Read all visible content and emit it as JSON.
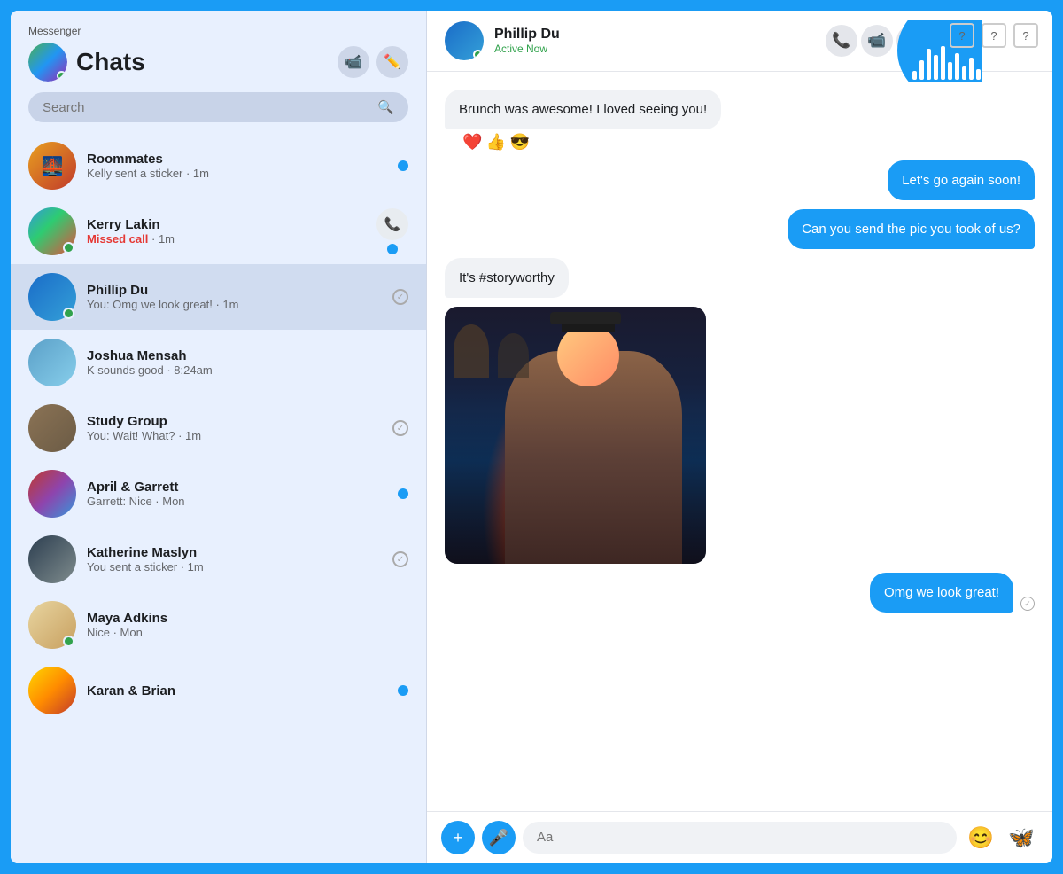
{
  "app": {
    "title": "Messenger",
    "border_color": "#1a9cf5"
  },
  "sidebar": {
    "title": "Chats",
    "search_placeholder": "Search",
    "header_actions": {
      "video_label": "📹",
      "compose_label": "✏️"
    },
    "chats": [
      {
        "id": "roommates",
        "name": "Roommates",
        "preview": "Kelly sent a sticker · 1m",
        "unread": true,
        "online": false,
        "avatar_type": "roommates",
        "avatar_emoji": "🌉"
      },
      {
        "id": "kerry-lakin",
        "name": "Kerry Lakin",
        "preview": "Missed call · 1m",
        "missed_call": true,
        "unread": true,
        "online": true,
        "avatar_type": "kerry",
        "show_phone": true
      },
      {
        "id": "phillip-du",
        "name": "Phillip Du",
        "preview": "You: Omg we look great! · 1m",
        "unread": false,
        "online": true,
        "avatar_type": "phillip",
        "active": true,
        "show_check": true
      },
      {
        "id": "joshua-mensah",
        "name": "Joshua Mensah",
        "preview": "K sounds good · 8:24am",
        "unread": false,
        "online": false,
        "avatar_type": "joshua"
      },
      {
        "id": "study-group",
        "name": "Study Group",
        "preview": "You: Wait! What? · 1m",
        "unread": false,
        "online": false,
        "avatar_type": "study",
        "show_check": true
      },
      {
        "id": "april-garrett",
        "name": "April & Garrett",
        "preview": "Garrett: Nice · Mon",
        "unread": true,
        "online": false,
        "avatar_type": "april"
      },
      {
        "id": "katherine-maslyn",
        "name": "Katherine Maslyn",
        "preview": "You sent a sticker · 1m",
        "unread": false,
        "online": false,
        "avatar_type": "katherine",
        "show_check": true
      },
      {
        "id": "maya-adkins",
        "name": "Maya Adkins",
        "preview": "Nice · Mon",
        "unread": false,
        "online": true,
        "avatar_type": "maya"
      },
      {
        "id": "karan-brian",
        "name": "Karan & Brian",
        "preview": "",
        "unread": true,
        "online": false,
        "avatar_type": "karan"
      }
    ]
  },
  "chat": {
    "partner_name": "Phillip Du",
    "partner_status": "Active Now",
    "messages": [
      {
        "id": "msg1",
        "type": "incoming",
        "text": "Brunch was awesome! I loved seeing you!",
        "reactions": [
          "❤️",
          "👍",
          "😎"
        ]
      },
      {
        "id": "msg2",
        "type": "outgoing",
        "text": "Let's go again soon!"
      },
      {
        "id": "msg3",
        "type": "outgoing",
        "text": "Can you send the pic you took of us?"
      },
      {
        "id": "msg4",
        "type": "incoming",
        "text": "It's #storyworthy"
      },
      {
        "id": "msg5",
        "type": "incoming",
        "is_photo": true
      },
      {
        "id": "msg6",
        "type": "outgoing",
        "text": "Omg we look great!",
        "delivered": true
      }
    ],
    "input_placeholder": "Aa",
    "actions": {
      "call": "📞",
      "video": "📹",
      "more": "⋮"
    }
  },
  "topbar_help": [
    "?",
    "?",
    "?"
  ]
}
